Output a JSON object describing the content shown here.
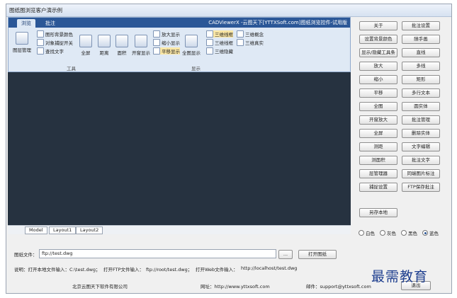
{
  "window": {
    "title": "图纸图浏览客户演示例"
  },
  "ribbon": {
    "tabs": [
      "浏览",
      "批注"
    ],
    "title": "CADViewerX -云图天下[YTTXSoft.com]图纸浏览控件-试用版",
    "big": [
      "图层管理",
      "全屏",
      "距离",
      "面积",
      "开窗显示",
      "全图显示"
    ],
    "small": [
      "图形背景颜色",
      "对象捕捉开关",
      "查找文字",
      "放大显示",
      "缩小显示",
      "平移显示",
      "三维线框",
      "三维线框",
      "三维隐藏",
      "三维概念",
      "三维真实"
    ],
    "groups": [
      "工具",
      "显示"
    ]
  },
  "layout_tabs": [
    "Model",
    "Layout1",
    "Layout2"
  ],
  "buttons": [
    "关于",
    "批注设置",
    "设置背景颜色",
    "随手画",
    "显示/隐藏工具条",
    "直线",
    "放大",
    "多线",
    "缩小",
    "矩形",
    "平移",
    "多行文本",
    "全图",
    "圆实体",
    "开窗放大",
    "批注管理",
    "全屏",
    "删除实体",
    "测距",
    "文字编辑",
    "测面积",
    "批注文字",
    "层管理器",
    "同端图片标注",
    "捕捉设置",
    "FTP保存批注"
  ],
  "save_local": "另存本地",
  "bg_options": {
    "items": [
      "白色",
      "灰色",
      "黑色",
      "蓝色"
    ],
    "selected": "蓝色"
  },
  "file": {
    "label": "图纸文件：",
    "value": "ftp://test.dwg",
    "browse": "...",
    "open": "打开图纸"
  },
  "help": {
    "label": "说明：打开本地文件输入：",
    "local": "C:\\test.dwg；",
    "ftp_label": "打开FTP文件输入：",
    "ftp": "ftp://root/test.dwg；",
    "web_label": "打开Web文件输入：",
    "web": "http://localhost/test.dwg"
  },
  "footer": {
    "company": "北京云图天下软件有限公司",
    "site": "网址：http://www.yttxsoft.com",
    "mail": "邮件：support@yttxsoft.com",
    "exit": "退出"
  },
  "watermark": "最需教育",
  "colors": {
    "canvas": "#263240",
    "ribbon_tab": "#2b5797"
  }
}
